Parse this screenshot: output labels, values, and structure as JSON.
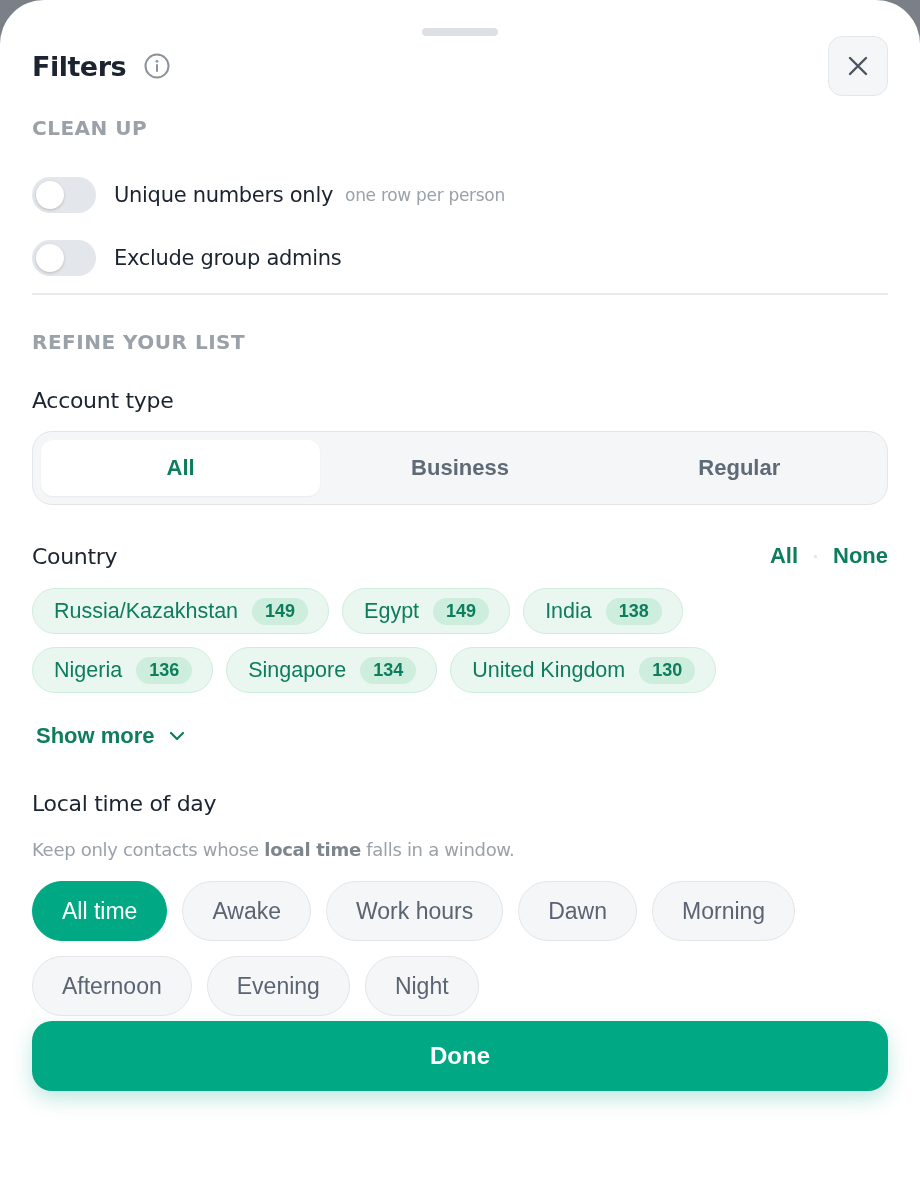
{
  "title": "Filters",
  "clean_up": {
    "heading": "CLEAN UP",
    "toggles": [
      {
        "label": "Unique numbers only",
        "hint": "one row per person",
        "on": false
      },
      {
        "label": "Exclude group admins",
        "on": false
      }
    ]
  },
  "refine": {
    "heading": "REFINE YOUR LIST",
    "account_type": {
      "label": "Account type",
      "options": [
        {
          "label": "All",
          "selected": true
        },
        {
          "label": "Business",
          "selected": false
        },
        {
          "label": "Regular",
          "selected": false
        }
      ]
    },
    "country": {
      "label": "Country",
      "actions": [
        "All",
        "None"
      ],
      "chips": [
        {
          "name": "Russia/Kazakhstan",
          "count": "149",
          "selected": true
        },
        {
          "name": "Egypt",
          "count": "149",
          "selected": true
        },
        {
          "name": "India",
          "count": "138",
          "selected": true
        },
        {
          "name": "Nigeria",
          "count": "136",
          "selected": true
        },
        {
          "name": "Singapore",
          "count": "134",
          "selected": true
        },
        {
          "name": "United Kingdom",
          "count": "130",
          "selected": true
        }
      ],
      "show_more": "Show more"
    },
    "local_time": {
      "label": "Local time of day",
      "description": "Keep only contacts whose **local time** falls in a window.",
      "options": [
        {
          "label": "All time",
          "selected": true
        },
        {
          "label": "Awake",
          "selected": false
        },
        {
          "label": "Work hours",
          "selected": false
        },
        {
          "label": "Dawn",
          "selected": false
        },
        {
          "label": "Morning",
          "selected": false
        },
        {
          "label": "Afternoon",
          "selected": false
        },
        {
          "label": "Evening",
          "selected": false
        },
        {
          "label": "Night",
          "selected": false
        }
      ]
    }
  },
  "done_button": "Done"
}
